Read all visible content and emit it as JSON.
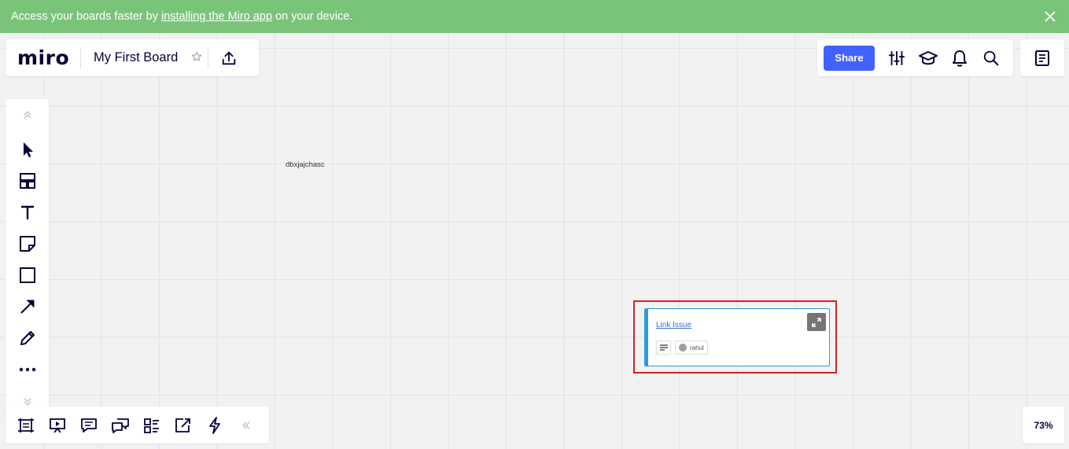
{
  "banner": {
    "text_before": "Access your boards faster by",
    "link_text": "installing the Miro app",
    "text_after": "on your device.",
    "close_icon": "close-icon"
  },
  "header": {
    "logo": "miro",
    "board_title": "My First Board",
    "share_label": "Share"
  },
  "icons": {
    "top_left": [
      "star-icon",
      "export-upload-icon"
    ],
    "top_right": [
      "settings-sliders-icon",
      "learning-cap-icon",
      "bell-icon",
      "search-icon"
    ],
    "notes": "notes-icon",
    "toolbar": [
      "collapse-up-icon",
      "select-cursor-icon",
      "templates-icon",
      "text-icon",
      "sticky-note-icon",
      "shape-rectangle-icon",
      "arrow-line-icon",
      "pen-icon",
      "more-icon",
      "collapse-down-icon"
    ],
    "bottom": [
      "frames-icon",
      "presentation-icon",
      "comments-icon",
      "chat-icon",
      "card-list-icon",
      "share-screen-icon",
      "lightning-icon",
      "collapse-left-icon"
    ]
  },
  "board": {
    "text_item": "dbxjajchasc",
    "card": {
      "title": "Link Issue",
      "assignee": "rahul"
    }
  },
  "zoom": "73%",
  "colors": {
    "banner": "#7ac47a",
    "share_button": "#4262ff",
    "card_accent": "#2d9cdb",
    "highlight": "#d71f26"
  }
}
